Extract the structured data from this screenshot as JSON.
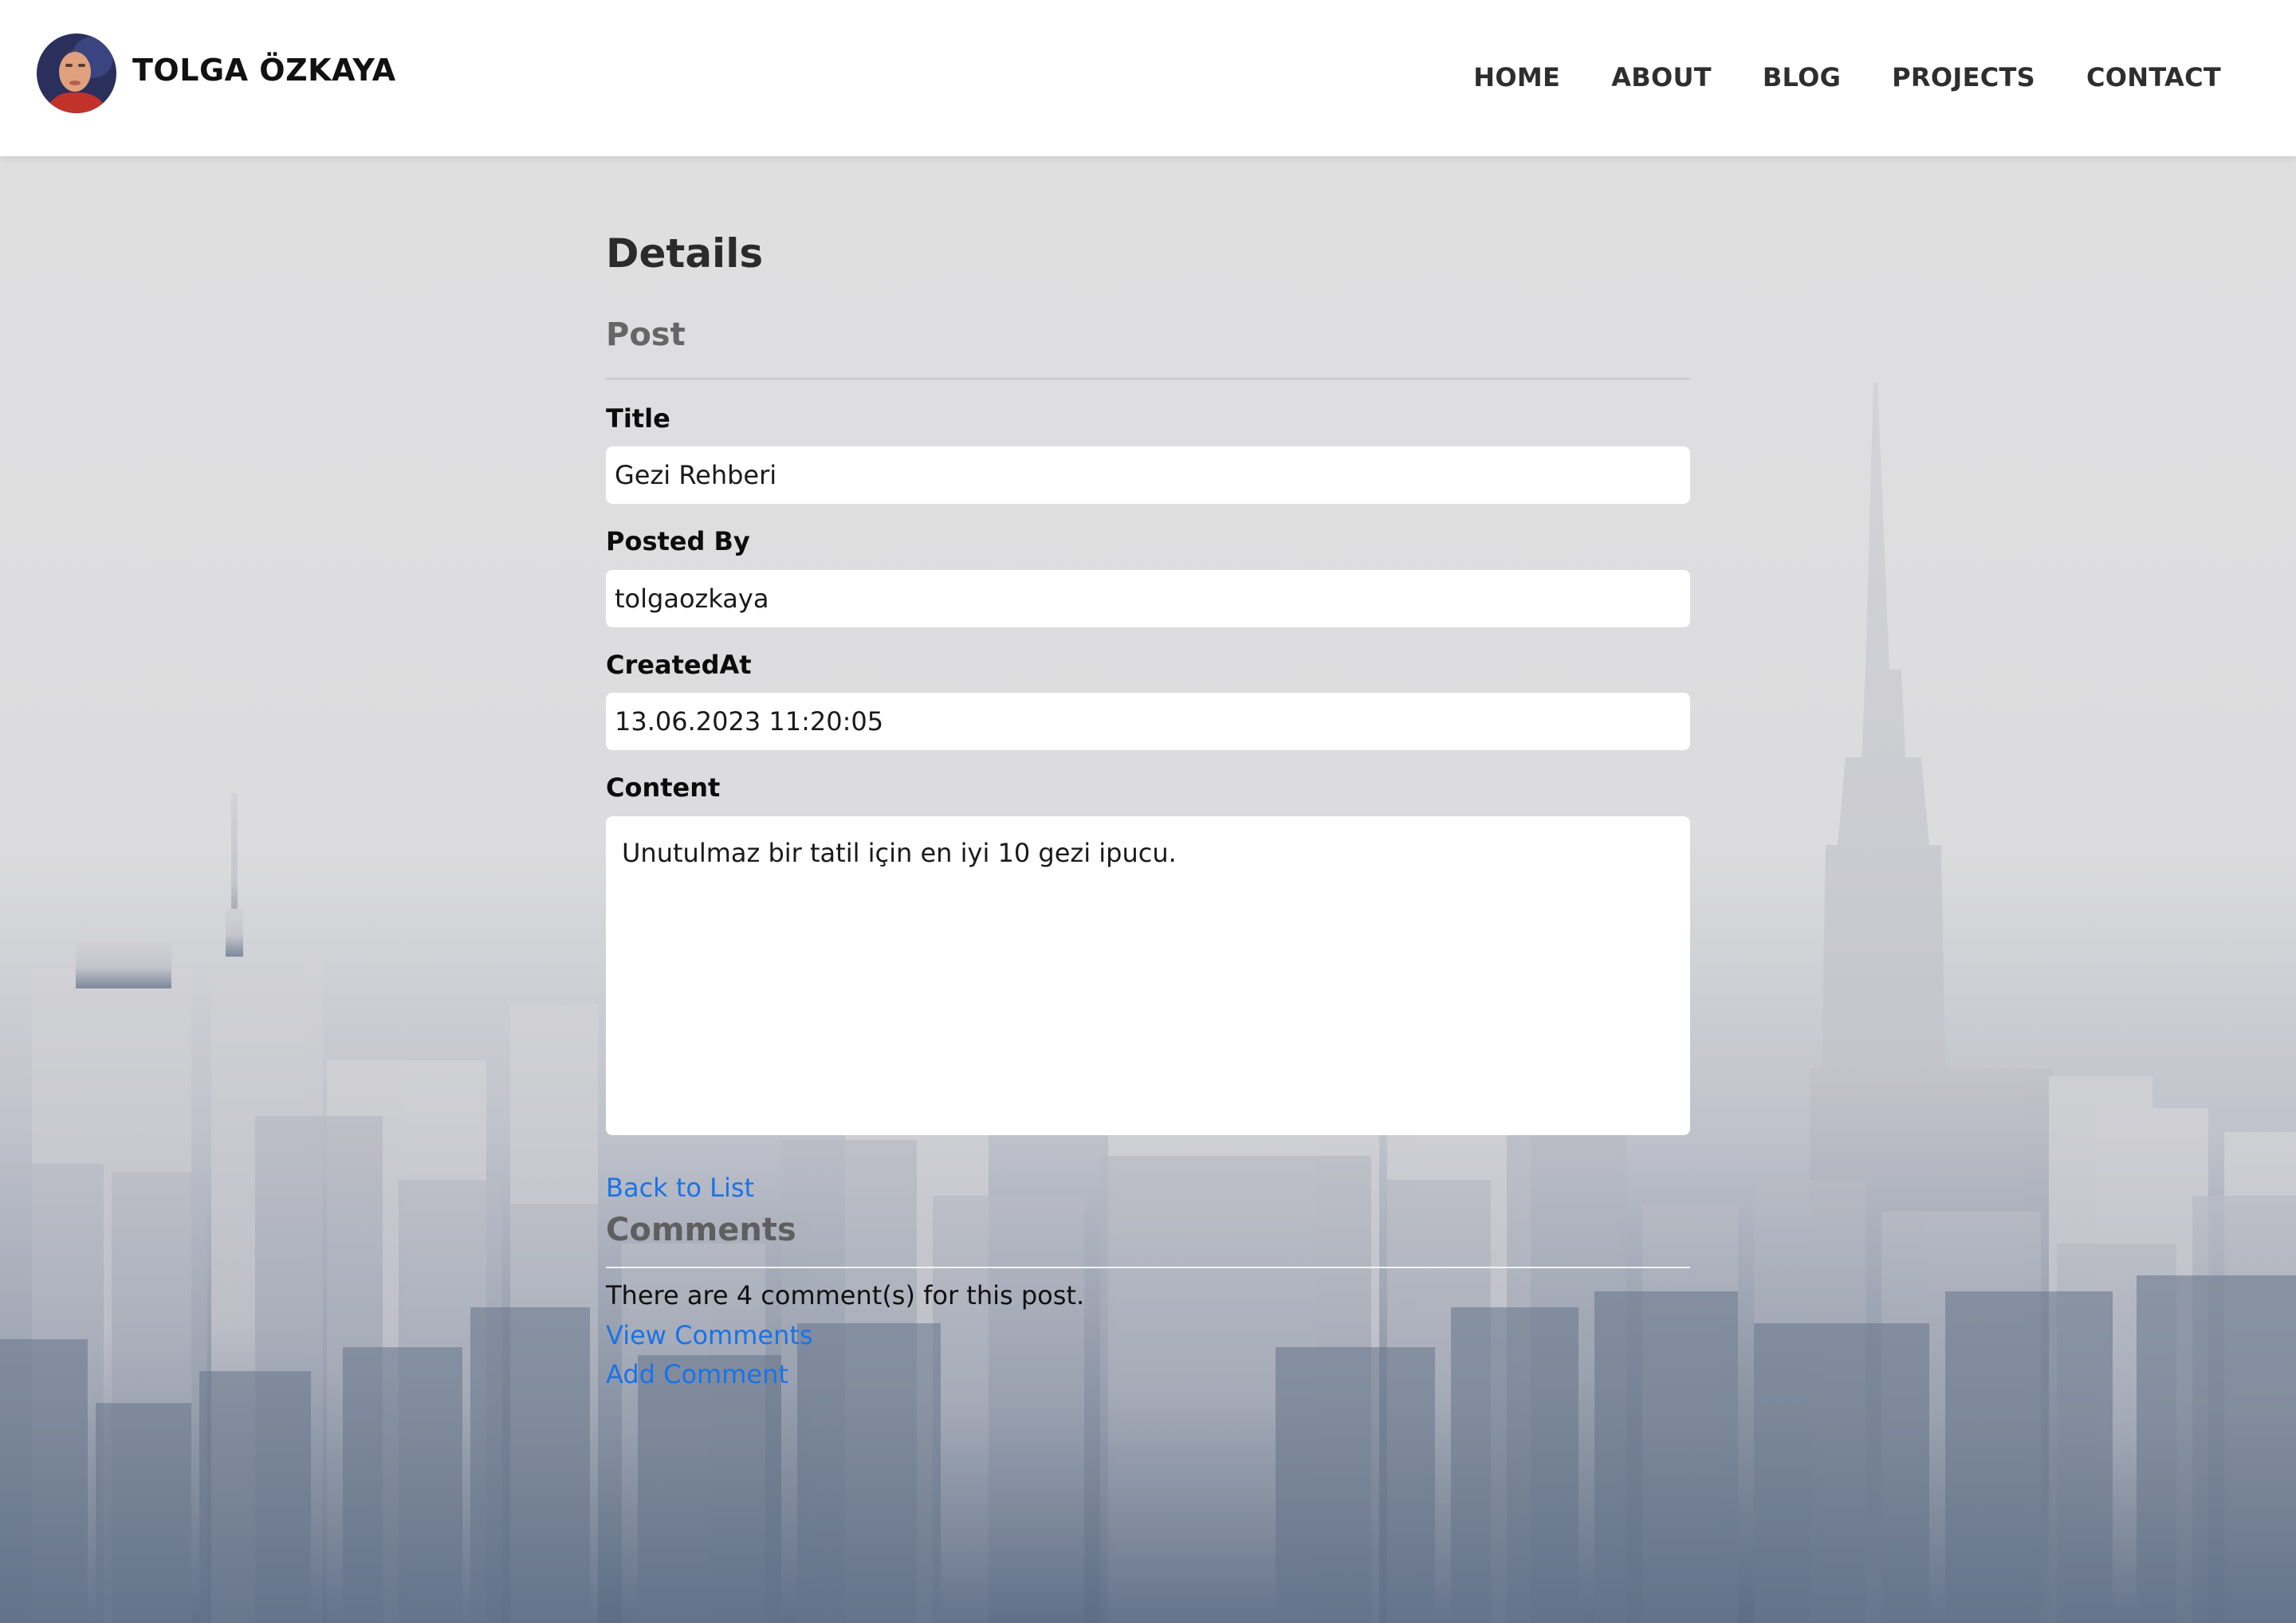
{
  "header": {
    "brand": "TOLGA ÖZKAYA",
    "avatar_icon": "user-avatar-photo",
    "nav": [
      {
        "label": "HOME"
      },
      {
        "label": "ABOUT"
      },
      {
        "label": "BLOG"
      },
      {
        "label": "PROJECTS"
      },
      {
        "label": "CONTACT"
      }
    ]
  },
  "details": {
    "page_title": "Details",
    "section_title": "Post",
    "fields": {
      "title_label": "Title",
      "title_value": "Gezi Rehberi",
      "posted_by_label": "Posted By",
      "posted_by_value": "tolgaozkaya",
      "created_at_label": "CreatedAt",
      "created_at_value": "13.06.2023 11:20:05",
      "content_label": "Content",
      "content_value": "Unutulmaz bir tatil için en iyi 10 gezi ipucu."
    },
    "back_link": "Back to List"
  },
  "comments": {
    "title": "Comments",
    "count_text": "There are 4 comment(s) for this post.",
    "view_link": "View Comments",
    "add_link": "Add Comment"
  },
  "colors": {
    "header_bg": "#ffffff",
    "page_bg": "#e0e0e1",
    "link": "#1a73e8",
    "skyline_bottom": "#5d6d84"
  }
}
